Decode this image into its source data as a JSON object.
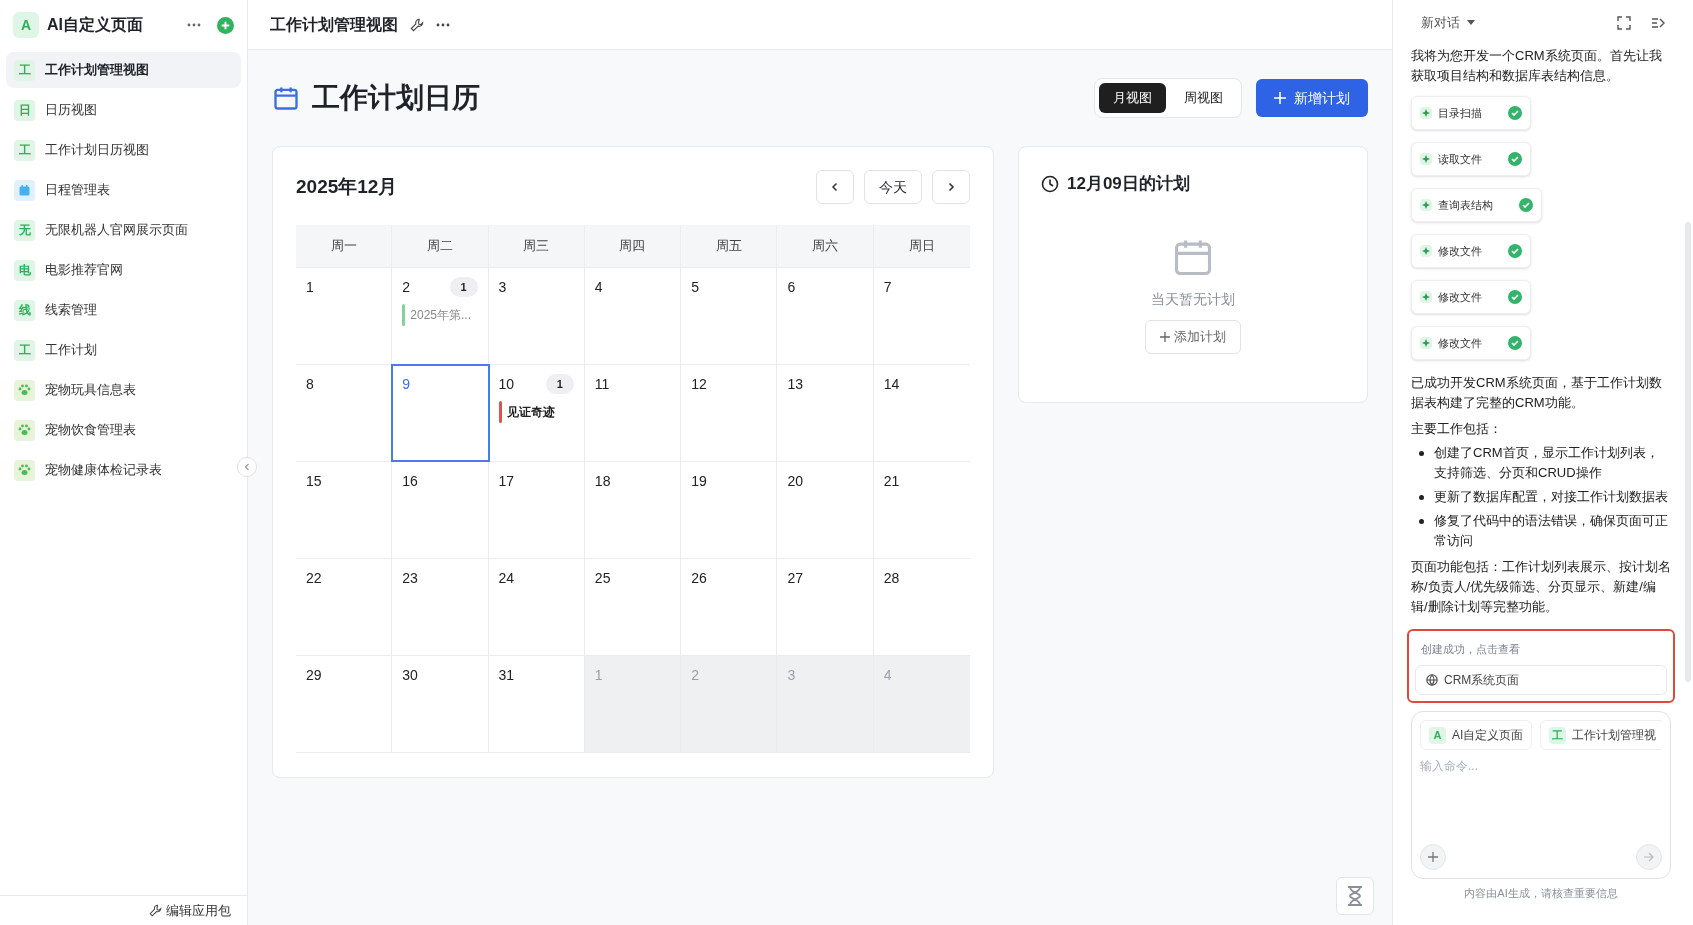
{
  "sidebar": {
    "app": {
      "badge": "A",
      "title": "AI自定义页面"
    },
    "items": [
      {
        "kind": "letter",
        "badge": "工",
        "label": "工作计划管理视图",
        "selected": true
      },
      {
        "kind": "letter",
        "badge": "日",
        "label": "日历视图",
        "selected": false
      },
      {
        "kind": "letter",
        "badge": "工",
        "label": "工作计划日历视图",
        "selected": false
      },
      {
        "kind": "calendar",
        "label": "日程管理表",
        "selected": false
      },
      {
        "kind": "letter",
        "badge": "无",
        "label": "无限机器人官网展示页面",
        "selected": false
      },
      {
        "kind": "letter",
        "badge": "电",
        "label": "电影推荐官网",
        "selected": false
      },
      {
        "kind": "letter",
        "badge": "线",
        "label": "线索管理",
        "selected": false
      },
      {
        "kind": "letter",
        "badge": "工",
        "label": "工作计划",
        "selected": false
      },
      {
        "kind": "paw",
        "label": "宠物玩具信息表",
        "selected": false
      },
      {
        "kind": "paw",
        "label": "宠物饮食管理表",
        "selected": false
      },
      {
        "kind": "paw",
        "label": "宠物健康体检记录表",
        "selected": false
      }
    ],
    "footer": "编辑应用包"
  },
  "header": {
    "title": "工作计划管理视图"
  },
  "page": {
    "title": "工作计划日历",
    "views": [
      {
        "label": "月视图",
        "selected": true
      },
      {
        "label": "周视图",
        "selected": false
      }
    ],
    "add_button": "新增计划"
  },
  "calendar": {
    "month": "2025年12月",
    "today": "今天",
    "weekdays": [
      "周一",
      "周二",
      "周三",
      "周四",
      "周五",
      "周六",
      "周日"
    ],
    "weeks": [
      [
        {
          "day": "1",
          "outside": false,
          "selected": false
        },
        {
          "day": "2",
          "outside": false,
          "selected": false,
          "count": "1",
          "event": {
            "title": "2025年第...",
            "color": "#86d39a",
            "faded": true
          }
        },
        {
          "day": "3",
          "outside": false,
          "selected": false
        },
        {
          "day": "4",
          "outside": false,
          "selected": false
        },
        {
          "day": "5",
          "outside": false,
          "selected": false
        },
        {
          "day": "6",
          "outside": false,
          "selected": false
        },
        {
          "day": "7",
          "outside": false,
          "selected": false
        }
      ],
      [
        {
          "day": "8",
          "outside": false,
          "selected": false
        },
        {
          "day": "9",
          "outside": false,
          "selected": true
        },
        {
          "day": "10",
          "outside": false,
          "selected": false,
          "count": "1",
          "event": {
            "title": "见证奇迹",
            "color": "#e05252",
            "faded": false
          }
        },
        {
          "day": "11",
          "outside": false,
          "selected": false
        },
        {
          "day": "12",
          "outside": false,
          "selected": false
        },
        {
          "day": "13",
          "outside": false,
          "selected": false
        },
        {
          "day": "14",
          "outside": false,
          "selected": false
        }
      ],
      [
        {
          "day": "15",
          "outside": false,
          "selected": false
        },
        {
          "day": "16",
          "outside": false,
          "selected": false
        },
        {
          "day": "17",
          "outside": false,
          "selected": false
        },
        {
          "day": "18",
          "outside": false,
          "selected": false
        },
        {
          "day": "19",
          "outside": false,
          "selected": false
        },
        {
          "day": "20",
          "outside": false,
          "selected": false
        },
        {
          "day": "21",
          "outside": false,
          "selected": false
        }
      ],
      [
        {
          "day": "22",
          "outside": false,
          "selected": false
        },
        {
          "day": "23",
          "outside": false,
          "selected": false
        },
        {
          "day": "24",
          "outside": false,
          "selected": false
        },
        {
          "day": "25",
          "outside": false,
          "selected": false
        },
        {
          "day": "26",
          "outside": false,
          "selected": false
        },
        {
          "day": "27",
          "outside": false,
          "selected": false
        },
        {
          "day": "28",
          "outside": false,
          "selected": false
        }
      ],
      [
        {
          "day": "29",
          "outside": false,
          "selected": false
        },
        {
          "day": "30",
          "outside": false,
          "selected": false
        },
        {
          "day": "31",
          "outside": false,
          "selected": false
        },
        {
          "day": "1",
          "outside": true,
          "selected": false
        },
        {
          "day": "2",
          "outside": true,
          "selected": false
        },
        {
          "day": "3",
          "outside": true,
          "selected": false
        },
        {
          "day": "4",
          "outside": true,
          "selected": false
        }
      ]
    ]
  },
  "day_plan": {
    "title": "12月09日的计划",
    "empty": "当天暂无计划",
    "add": "添加计划"
  },
  "chat": {
    "title": "新对话",
    "intro": "我将为您开发一个CRM系统页面。首先让我获取项目结构和数据库表结构信息。",
    "steps": [
      {
        "label": "目录扫描",
        "done": true
      },
      {
        "label": "读取文件",
        "done": true
      },
      {
        "label": "查询表结构",
        "done": true
      },
      {
        "label": "修改文件",
        "done": true
      },
      {
        "label": "修改文件",
        "done": true
      },
      {
        "label": "修改文件",
        "done": true
      }
    ],
    "summary": "已成功开发CRM系统页面，基于工作计划数据表构建了完整的CRM功能。",
    "list_title": "主要工作包括：",
    "bullets": [
      "创建了CRM首页，显示工作计划列表，支持筛选、分页和CRUD操作",
      "更新了数据库配置，对接工作计划数据表",
      "修复了代码中的语法错误，确保页面可正常访问"
    ],
    "features": "页面功能包括：工作计划列表展示、按计划名称/负责人/优先级筛选、分页显示、新建/编辑/删除计划等完整功能。",
    "result": {
      "caption": "创建成功，点击查看",
      "link": "CRM系统页面"
    },
    "context": [
      {
        "badge": "A",
        "label": "AI自定义页面"
      },
      {
        "badge": "工",
        "label": "工作计划管理视"
      }
    ],
    "input": {
      "placeholder": "输入命令..."
    },
    "disclaimer": "内容由AI生成，请核查重要信息"
  }
}
